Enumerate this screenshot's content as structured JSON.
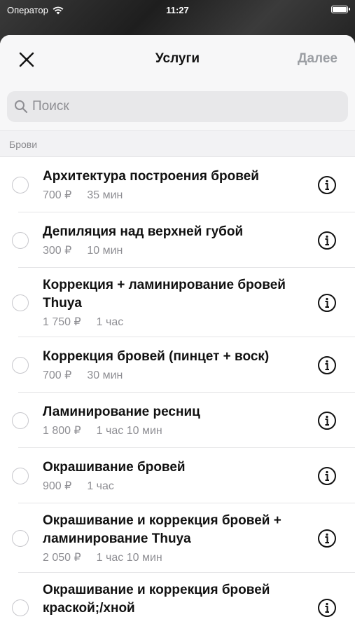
{
  "status": {
    "carrier": "Оператор",
    "time": "11:27"
  },
  "nav": {
    "title": "Услуги",
    "next_label": "Далее"
  },
  "search": {
    "placeholder": "Поиск"
  },
  "section": {
    "title": "Брови"
  },
  "services": [
    {
      "title": "Архитектура построения бровей",
      "price": "700 ₽",
      "duration": "35 мин"
    },
    {
      "title": "Депиляция над верхней губой",
      "price": "300 ₽",
      "duration": "10 мин"
    },
    {
      "title": "Коррекция + ламинирование бровей Thuya",
      "price": "1 750 ₽",
      "duration": "1 час"
    },
    {
      "title": "Коррекция бровей (пинцет + воск)",
      "price": "700 ₽",
      "duration": "30 мин"
    },
    {
      "title": "Ламинирование ресниц",
      "price": "1 800 ₽",
      "duration": "1 час 10 мин"
    },
    {
      "title": "Окрашивание бровей",
      "price": "900 ₽",
      "duration": "1 час"
    },
    {
      "title": "Окрашивание и коррекция бровей + ламинирование Thuya",
      "price": "2 050 ₽",
      "duration": "1 час 10 мин"
    },
    {
      "title": "Окрашивание и коррекция бровей краской;/хной",
      "price": "",
      "duration": ""
    }
  ]
}
